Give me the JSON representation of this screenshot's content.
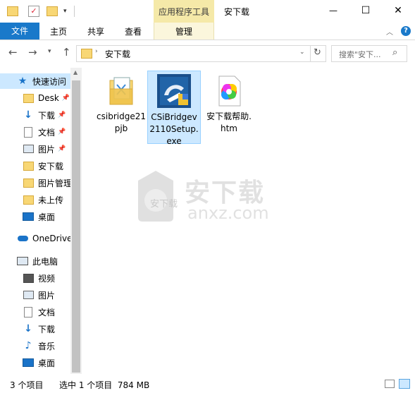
{
  "window": {
    "title": "安下载",
    "context_tab": "应用程序工具",
    "controls": {
      "minimize": "—",
      "maximize": "☐",
      "close": "✕"
    }
  },
  "ribbon": {
    "file_tab": "文件",
    "tabs": [
      "主页",
      "共享",
      "查看"
    ],
    "context_tab": "管理",
    "collapse_icon": "chevron-down-icon",
    "help_icon": "help-icon"
  },
  "nav": {
    "breadcrumb": "安下载",
    "search_placeholder": "搜索\"安下...",
    "dropdown_icon": "chevron-down-icon",
    "refresh_icon": "refresh-icon"
  },
  "sidebar": {
    "quick_access": "快速访问",
    "items": [
      {
        "label": "Desk",
        "pinned": true,
        "icon": "folder-icon"
      },
      {
        "label": "下载",
        "pinned": true,
        "icon": "download-icon"
      },
      {
        "label": "文档",
        "pinned": true,
        "icon": "document-icon"
      },
      {
        "label": "图片",
        "pinned": true,
        "icon": "picture-icon"
      },
      {
        "label": "安下载",
        "pinned": false,
        "icon": "folder-icon"
      },
      {
        "label": "图片管理",
        "pinned": false,
        "icon": "folder-icon"
      },
      {
        "label": "未上传",
        "pinned": false,
        "icon": "folder-icon"
      },
      {
        "label": "桌面",
        "pinned": false,
        "icon": "desktop-icon"
      }
    ],
    "onedrive": "OneDrive",
    "this_pc": "此电脑",
    "pc_items": [
      {
        "label": "视频",
        "icon": "video-icon"
      },
      {
        "label": "图片",
        "icon": "picture-icon"
      },
      {
        "label": "文档",
        "icon": "document-icon"
      },
      {
        "label": "下载",
        "icon": "download-icon"
      },
      {
        "label": "音乐",
        "icon": "music-icon"
      },
      {
        "label": "桌面",
        "icon": "desktop-icon"
      }
    ]
  },
  "files": [
    {
      "name": "csibridge21pjb",
      "icon": "folder-icon",
      "selected": false
    },
    {
      "name": "CSiBridgev2110Setup.exe",
      "icon": "installer-icon",
      "selected": true
    },
    {
      "name": "安下载帮助.htm",
      "icon": "html-file-icon",
      "selected": false
    }
  ],
  "status": {
    "count": "3 个项目",
    "selection": "选中 1 个项目  784 MB"
  },
  "watermark": {
    "text": "安下载",
    "domain": "anxz.com"
  },
  "colors": {
    "accent": "#1979ca",
    "selected_bg": "#cce8ff",
    "context_tab": "#f5e9a8",
    "folder": "#f8d775"
  }
}
